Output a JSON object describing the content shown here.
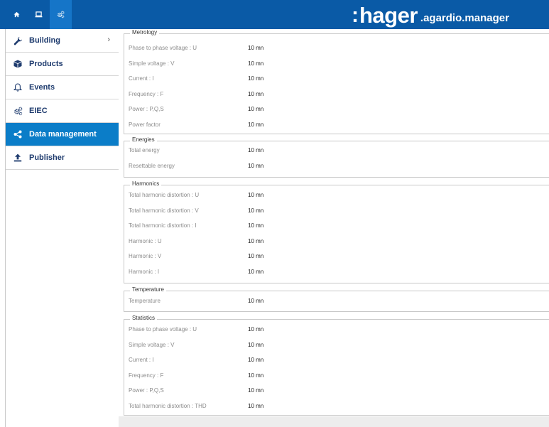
{
  "brand": {
    "colon": ":",
    "name": "hager",
    "sub": ".agardio.manager"
  },
  "top_icons": [
    "home-icon",
    "laptop-icon",
    "gears-icon"
  ],
  "sidebar": {
    "items": [
      {
        "label": "Building",
        "icon": "wrench-icon"
      },
      {
        "label": "Products",
        "icon": "box-icon"
      },
      {
        "label": "Events",
        "icon": "bell-icon"
      },
      {
        "label": "EIEC",
        "icon": "gears-icon"
      },
      {
        "label": "Data management",
        "icon": "share-icon"
      },
      {
        "label": "Publisher",
        "icon": "upload-icon"
      }
    ]
  },
  "sections": {
    "metrology": {
      "title": "Metrology",
      "rows": [
        {
          "label": "Phase to phase voltage : U",
          "value": "10 mn"
        },
        {
          "label": "Simple voltage : V",
          "value": "10 mn"
        },
        {
          "label": "Current : I",
          "value": "10 mn"
        },
        {
          "label": "Frequency : F",
          "value": "10 mn"
        },
        {
          "label": "Power : P,Q,S",
          "value": "10 mn"
        },
        {
          "label": "Power factor",
          "value": "10 mn"
        }
      ]
    },
    "energies": {
      "title": "Energies",
      "rows": [
        {
          "label": "Total energy",
          "value": "10 mn"
        },
        {
          "label": "Resettable energy",
          "value": "10 mn"
        }
      ]
    },
    "harmonics": {
      "title": "Harmonics",
      "rows": [
        {
          "label": "Total harmonic distortion : U",
          "value": "10 mn"
        },
        {
          "label": "Total harmonic distortion : V",
          "value": "10 mn"
        },
        {
          "label": "Total harmonic distortion : I",
          "value": "10 mn"
        },
        {
          "label": "Harmonic : U",
          "value": "10 mn"
        },
        {
          "label": "Harmonic : V",
          "value": "10 mn"
        },
        {
          "label": "Harmonic : I",
          "value": "10 mn"
        }
      ]
    },
    "temperature": {
      "title": "Temperature",
      "rows": [
        {
          "label": "Temperature",
          "value": "10 mn"
        }
      ]
    },
    "statistics": {
      "title": "Statistics",
      "rows": [
        {
          "label": "Phase to phase voltage : U",
          "value": "10 mn"
        },
        {
          "label": "Simple voltage : V",
          "value": "10 mn"
        },
        {
          "label": "Current : I",
          "value": "10 mn"
        },
        {
          "label": "Frequency : F",
          "value": "10 mn"
        },
        {
          "label": "Power : P,Q,S",
          "value": "10 mn"
        },
        {
          "label": "Total harmonic distortion : THD",
          "value": "10 mn"
        }
      ]
    }
  },
  "colors": {
    "topbar": "#0a5aa6",
    "active_nav": "#0b7dc8",
    "nav_text": "#1e3b6e"
  }
}
